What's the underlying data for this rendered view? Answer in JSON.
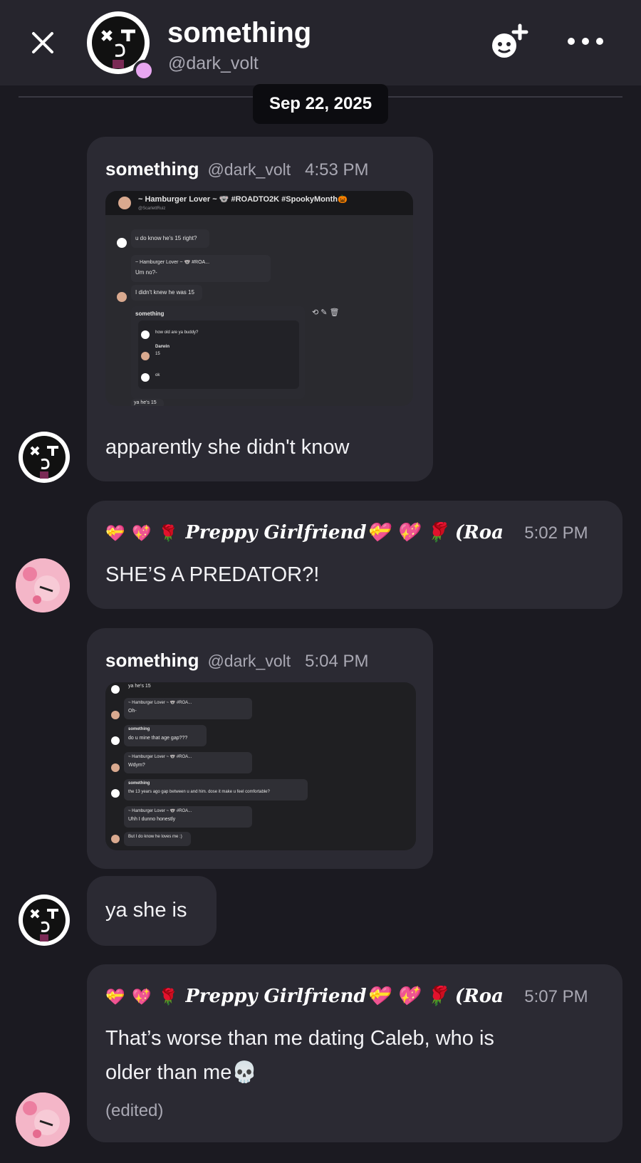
{
  "header": {
    "title": "something",
    "handle": "@dark_volt"
  },
  "date_separator": "Sep 22, 2025",
  "messages": [
    {
      "author": "something",
      "handle": "@dark_volt",
      "time": "4:53 PM",
      "text": "apparently she didn't know",
      "attachment": {
        "title": "~ Hamburger Lover ~ 🐨 #ROADTO2K #SpookyMonth🎃",
        "subtitle": "@ScarlettRuiz",
        "lines": [
          "u do know he's 15 right?",
          "~ Hamburger Lover ~ 🐨 #ROA...",
          "Um no?-",
          "I didn't knew he was 15",
          "something",
          "how old are ya buddy?",
          "Darwin",
          "15",
          "ok",
          "ya he's 15"
        ]
      }
    },
    {
      "emojis": [
        "💝",
        "💖",
        "🌹"
      ],
      "author": "Preppy Girlfriend💝 💖 🌹 (Roa",
      "time": "5:02 PM",
      "text": "SHE’S A PREDATOR?!"
    },
    {
      "author": "something",
      "handle": "@dark_volt",
      "time": "5:04 PM",
      "attachment": {
        "lines": [
          "ya he's 15",
          "~ Hamburger Lover ~ 🐨 #ROA...",
          "Oh-",
          "something",
          "do u mine that age gap???",
          "~ Hamburger Lover ~ 🐨 #ROA...",
          "Wdym?",
          "something",
          "the 13 years ago gap between u and him. dose it make u feel comfortable?",
          "~ Hamburger Lover ~ 🐨 #ROA...",
          "Uhh I dunno honestly",
          "But I do know he loves me :)"
        ]
      }
    },
    {
      "text": "ya she is"
    },
    {
      "emojis": [
        "💝",
        "💖",
        "🌹"
      ],
      "author": "Preppy Girlfriend💝 💖 🌹 (Roa",
      "time": "5:07 PM",
      "text_line1": "That’s worse than me dating Caleb, who is",
      "text_line2": "older than me💀",
      "edited": "(edited)"
    }
  ]
}
